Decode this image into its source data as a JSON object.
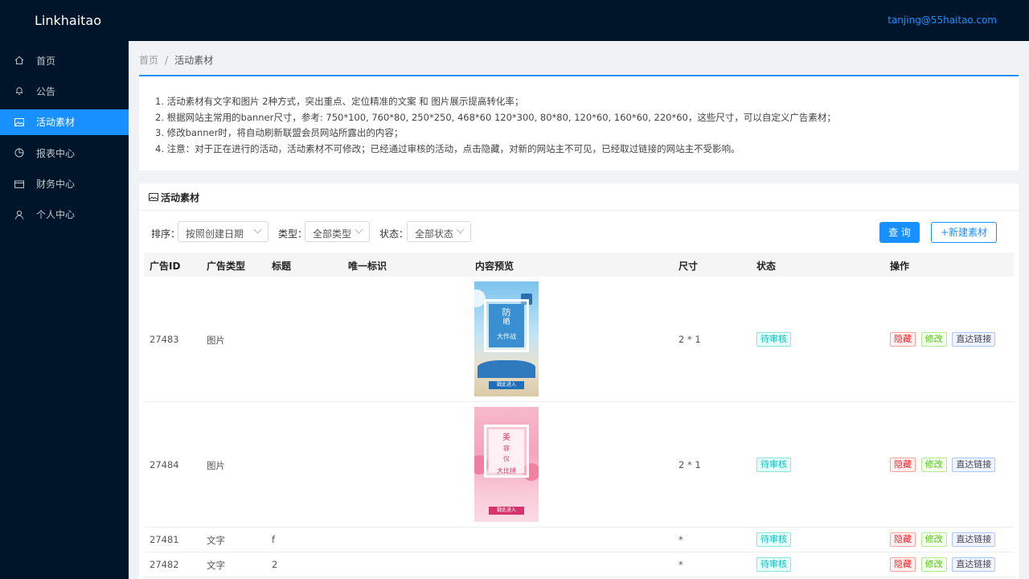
{
  "app": {
    "brand": "Linkhaitao",
    "user_email": "tanjing@55haitao.com"
  },
  "sidebar": {
    "items": [
      {
        "label": "首页",
        "icon": "home-icon"
      },
      {
        "label": "公告",
        "icon": "bell-icon"
      },
      {
        "label": "活动素材",
        "icon": "picture-icon",
        "active": true
      },
      {
        "label": "报表中心",
        "icon": "pie-chart-icon"
      },
      {
        "label": "财务中心",
        "icon": "wallet-icon"
      },
      {
        "label": "个人中心",
        "icon": "user-icon"
      }
    ]
  },
  "breadcrumb": {
    "home": "首页",
    "sep": "/",
    "current": "活动素材"
  },
  "notice": {
    "lines": [
      "1. 活动素材有文字和图片 2种方式，突出重点、定位精准的文案 和 图片展示提高转化率；",
      "2. 根据网站主常用的banner尺寸，参考: 750*100, 760*80, 250*250, 468*60 120*300, 80*80, 120*60, 160*60, 220*60，这些尺寸，可以自定义广告素材；",
      "3. 修改banner时，将自动刷新联盟会员网站所露出的内容；",
      "4. 注意：对于正在进行的活动，活动素材不可修改；已经通过审核的活动，点击隐藏，对新的网站主不可见，已经取过链接的网站主不受影响。"
    ]
  },
  "panel": {
    "title": "活动素材"
  },
  "filters": {
    "sort_label": "排序：",
    "sort_value": "按照创建日期",
    "type_label": "类型：",
    "type_value": "全部类型",
    "status_label": "状态：",
    "status_value": "全部状态",
    "query_button": "查 询",
    "new_button": "+新建素材"
  },
  "table": {
    "headers": [
      "广告ID",
      "广告类型",
      "标题",
      "唯一标识",
      "内容预览",
      "尺寸",
      "状态",
      "操作"
    ],
    "rows": [
      {
        "id": "27483",
        "type": "图片",
        "title": "",
        "uid": "",
        "size": "2 * 1",
        "status": "待审核",
        "preview": "sun",
        "banner": {
          "l1": "防",
          "l2": "晒",
          "l3": "大作战",
          "btn": "戳此进入"
        }
      },
      {
        "id": "27484",
        "type": "图片",
        "title": "",
        "uid": "",
        "size": "2 * 1",
        "status": "待审核",
        "preview": "beauty",
        "banner": {
          "l1": "美",
          "l2": "容",
          "l3": "仪",
          "l4": "大比拼",
          "btn": "戳此进入"
        }
      },
      {
        "id": "27481",
        "type": "文字",
        "title": "f",
        "uid": "",
        "size": "*",
        "status": "待审核"
      },
      {
        "id": "27482",
        "type": "文字",
        "title": "2",
        "uid": "",
        "size": "*",
        "status": "待审核"
      }
    ],
    "actions": {
      "hide": "隐藏",
      "edit": "修改",
      "link": "直达链接"
    }
  },
  "colors": {
    "primary": "#1890ff",
    "sidebar": "#001529",
    "pending": "#13c2c2",
    "danger": "#f5222d",
    "success": "#52c41a"
  }
}
